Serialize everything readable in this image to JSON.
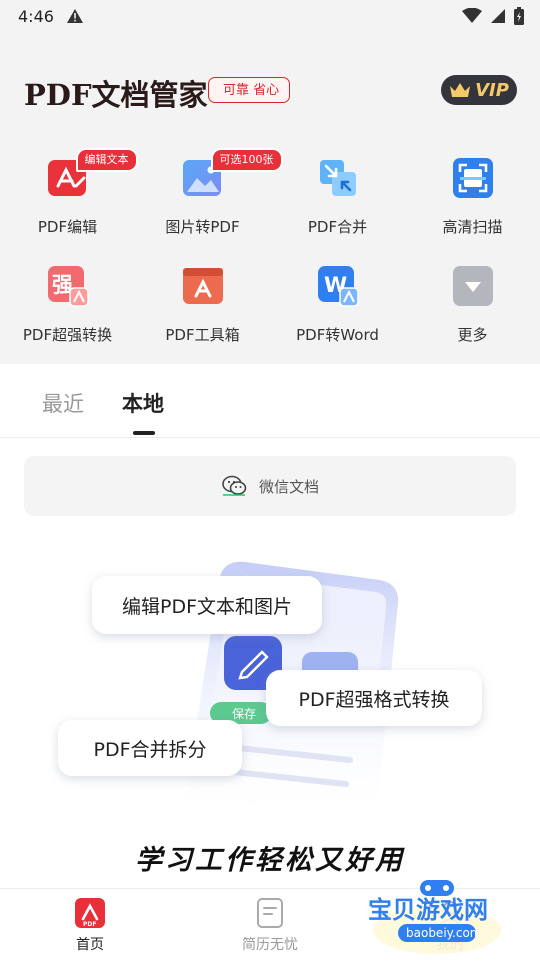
{
  "status_bar": {
    "time": "4:46"
  },
  "header": {
    "app_title": "PDF文档管家",
    "tagline": "可靠 省心",
    "vip_label": "VIP"
  },
  "tools": [
    {
      "label": "PDF编辑",
      "badge": "编辑文本",
      "icon": "pdf-edit-icon"
    },
    {
      "label": "图片转PDF",
      "badge": "可选100张",
      "icon": "image-to-pdf-icon"
    },
    {
      "label": "PDF合并",
      "badge": "",
      "icon": "pdf-merge-icon"
    },
    {
      "label": "高清扫描",
      "badge": "",
      "icon": "scan-icon"
    },
    {
      "label": "PDF超强转换",
      "badge": "",
      "icon": "pdf-convert-icon"
    },
    {
      "label": "PDF工具箱",
      "badge": "",
      "icon": "pdf-toolbox-icon"
    },
    {
      "label": "PDF转Word",
      "badge": "",
      "icon": "pdf-to-word-icon"
    },
    {
      "label": "更多",
      "badge": "",
      "icon": "more-icon"
    }
  ],
  "tabs": {
    "recent": "最近",
    "local": "本地",
    "active": "本地"
  },
  "wechat_docs": {
    "label": "微信文档",
    "icon": "wechat-icon"
  },
  "illustration": {
    "bubble_edit": "编辑PDF文本和图片",
    "bubble_convert": "PDF超强格式转换",
    "bubble_merge": "PDF合并拆分",
    "save_chip": "保存",
    "slogan": "学习工作轻松又好用"
  },
  "bottom_nav": [
    {
      "label": "首页",
      "icon": "home-pdf-icon",
      "active": true
    },
    {
      "label": "简历无忧",
      "icon": "resume-icon",
      "active": false
    },
    {
      "label": "我的",
      "icon": "profile-icon",
      "active": false
    }
  ],
  "watermark": {
    "title": "宝贝游戏网",
    "url": "baobeiy.com"
  },
  "colors": {
    "accent": "#e8303a",
    "vip_gold": "#f4c969",
    "vip_bg": "#34343c",
    "header_bg": "#f3f3f3"
  }
}
